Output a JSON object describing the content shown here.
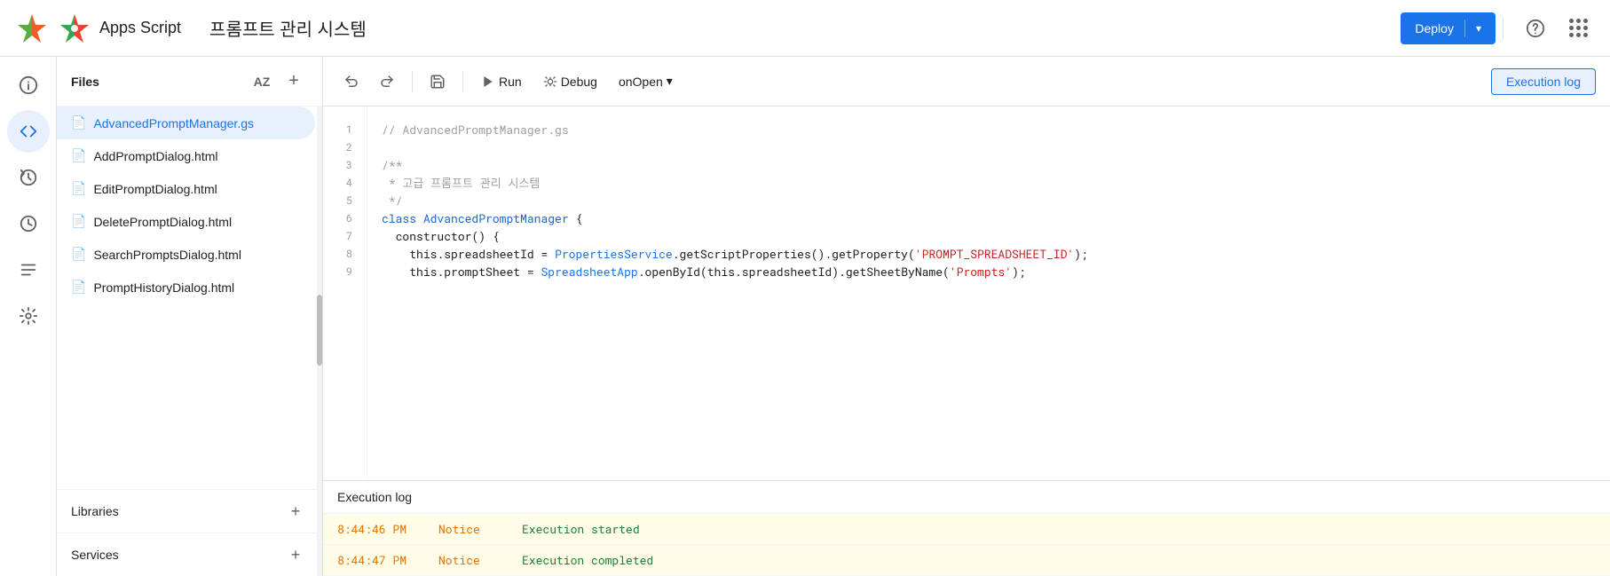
{
  "header": {
    "app_title": "Apps Script",
    "project_title": "프롬프트 관리 시스템",
    "deploy_label": "Deploy",
    "help_tooltip": "Help",
    "apps_tooltip": "Google apps"
  },
  "sidebar_icons": [
    {
      "name": "info-icon",
      "symbol": "ℹ",
      "active": false
    },
    {
      "name": "code-icon",
      "symbol": "<>",
      "active": true
    },
    {
      "name": "history-icon",
      "symbol": "⏱",
      "active": false
    },
    {
      "name": "clock-icon",
      "symbol": "⏰",
      "active": false
    },
    {
      "name": "list-icon",
      "symbol": "≡",
      "active": false
    },
    {
      "name": "settings-icon",
      "symbol": "⚙",
      "active": false
    }
  ],
  "files": {
    "title": "Files",
    "items": [
      {
        "name": "AdvancedPromptManager.gs",
        "active": true
      },
      {
        "name": "AddPromptDialog.html",
        "active": false
      },
      {
        "name": "EditPromptDialog.html",
        "active": false
      },
      {
        "name": "DeletePromptDialog.html",
        "active": false
      },
      {
        "name": "SearchPromptsDialog.html",
        "active": false
      },
      {
        "name": "PromptHistoryDialog.html",
        "active": false
      }
    ],
    "libraries_label": "Libraries",
    "services_label": "Services"
  },
  "toolbar": {
    "undo_label": "Undo",
    "redo_label": "Redo",
    "save_label": "Save",
    "run_label": "Run",
    "debug_label": "Debug",
    "function_label": "onOpen",
    "exec_log_label": "Execution log"
  },
  "code": {
    "filename": "AdvancedPromptManager.gs",
    "lines": [
      {
        "num": 1,
        "content": "// AdvancedPromptManager.gs"
      },
      {
        "num": 2,
        "content": ""
      },
      {
        "num": 3,
        "content": "/**"
      },
      {
        "num": 4,
        "content": " * 고급 프롬프트 관리 시스템"
      },
      {
        "num": 5,
        "content": " */"
      },
      {
        "num": 6,
        "content": "class AdvancedPromptManager {"
      },
      {
        "num": 7,
        "content": "  constructor() {"
      },
      {
        "num": 8,
        "content": "    this.spreadsheetId = PropertiesService.getScriptProperties().getProperty('PROMPT_SPREADSHEET_ID');"
      },
      {
        "num": 9,
        "content": "    this.promptSheet = SpreadsheetApp.openById(this.spreadsheetId).getSheetByName('Prompts');"
      }
    ]
  },
  "execution_log": {
    "title": "Execution log",
    "entries": [
      {
        "time": "8:44:46 PM",
        "level": "Notice",
        "message": "Execution started"
      },
      {
        "time": "8:44:47 PM",
        "level": "Notice",
        "message": "Execution completed"
      }
    ]
  }
}
